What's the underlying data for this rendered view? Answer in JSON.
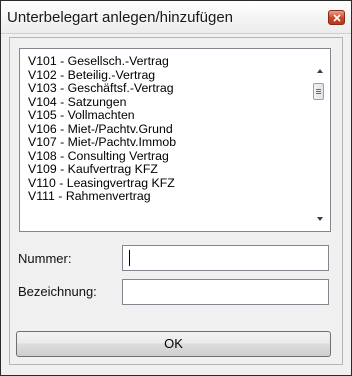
{
  "window": {
    "title": "Unterbelegart anlegen/hinzufügen",
    "close_icon": "close-icon"
  },
  "listbox": {
    "items": [
      "V101 - Gesellsch.-Vertrag",
      "V102 - Beteilig.-Vertrag",
      "V103 - Geschäftsf.-Vertrag",
      "V104 - Satzungen",
      "V105 - Vollmachten",
      "V106 - Miet-/Pachtv.Grund",
      "V107 - Miet-/Pachtv.Immob",
      "V108 - Consulting Vertrag",
      "V109 - Kaufvertrag KFZ",
      "V110 - Leasingvertrag KFZ",
      "V111 - Rahmenvertrag"
    ]
  },
  "form": {
    "nummer_label": "Nummer:",
    "nummer_value": "",
    "bezeichnung_label": "Bezeichnung:",
    "bezeichnung_value": ""
  },
  "buttons": {
    "ok_label": "OK"
  },
  "colors": {
    "close_button": "#c8472a",
    "window_bg": "#f0f0f0"
  }
}
